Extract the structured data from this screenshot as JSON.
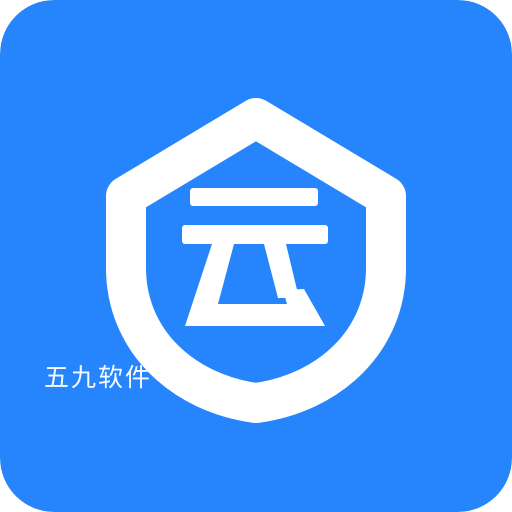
{
  "icon": {
    "background_color": "#2685fd",
    "foreground_color": "#ffffff",
    "glyph": "云",
    "glyph_icon": "cloud-character-icon",
    "emblem_icon": "shield-icon"
  },
  "watermark": {
    "text": "五九软件"
  }
}
